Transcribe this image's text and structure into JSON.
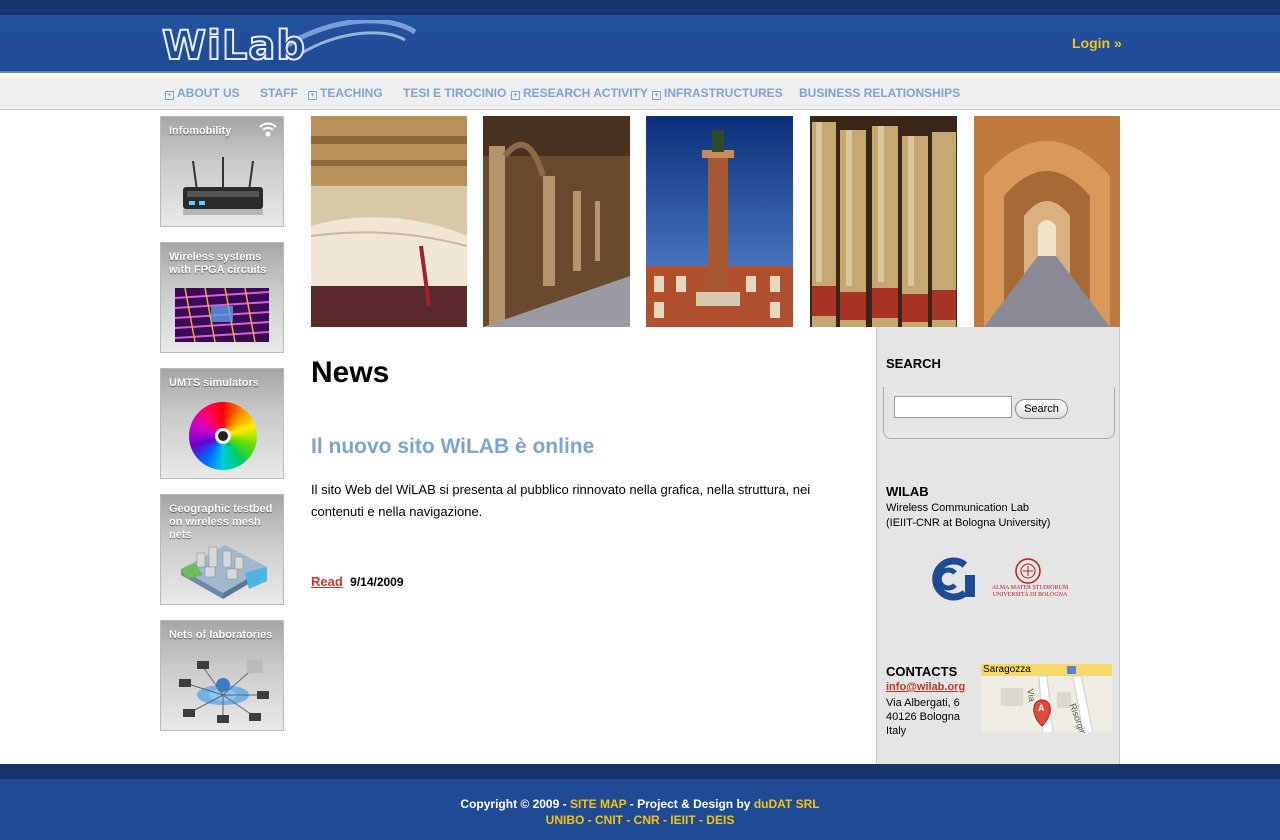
{
  "header": {
    "logo_text": "WiLab",
    "login_label": "Login »"
  },
  "nav": {
    "items": [
      {
        "label": "ABOUT US"
      },
      {
        "label": "STAFF"
      },
      {
        "label": "TEACHING"
      },
      {
        "label": "TESI E TIROCINIO"
      },
      {
        "label": "RESEARCH ACTIVITY"
      },
      {
        "label": "INFRASTRUCTURES"
      },
      {
        "label": "BUSINESS RELATIONSHIPS"
      }
    ]
  },
  "tiles": [
    {
      "title": "Infomobility"
    },
    {
      "title": "Wireless systems with FPGA circuits"
    },
    {
      "title": "UMTS simulators"
    },
    {
      "title": "Geographic testbed on wireless mesh nets"
    },
    {
      "title": "Nets of laboratories"
    }
  ],
  "main": {
    "title": "News",
    "news": {
      "title": "Il nuovo sito WiLAB è online",
      "body": "Il sito Web del WiLAB si presenta al pubblico rinnovato nella grafica, nella struttura, nei contenuti e nella navigazione.",
      "read_label": "Read",
      "date": "9/14/2009"
    }
  },
  "sidebar": {
    "search_heading": "SEARCH",
    "search_value": "",
    "search_button": "Search",
    "wilab_heading": "WILAB",
    "wilab_line1": "Wireless Communication Lab",
    "wilab_line2": "(IEIIT-CNR at Bologna University)",
    "unibo_logo_text": "ALMA MATER STUDIORUM UNIVERSITÀ DI BOLOGNA",
    "contacts_heading": "CONTACTS",
    "email": "info@wilab.org",
    "address_line1": "Via Albergati, 6",
    "address_line2": "40126 Bologna",
    "address_line3": "Italy",
    "map_label_street1": "Saragozza",
    "map_label_street2": "Risorgimento",
    "map_label_street3": "Via",
    "map_marker": "A"
  },
  "footer": {
    "copyright": "Copyright © 2009 -",
    "sitemap": "SITE MAP",
    "project": "- Project & Design by",
    "dudat": "duDAT SRL",
    "partners": "UNIBO - CNIT - CNR - IEIIT - DEIS"
  },
  "colors": {
    "header_blue": "#1f4a94",
    "accent_yellow": "#f3c316",
    "nav_text": "#7fa3cf",
    "link_red": "#c0392b",
    "sidebar_bg": "#e5e5e5"
  }
}
